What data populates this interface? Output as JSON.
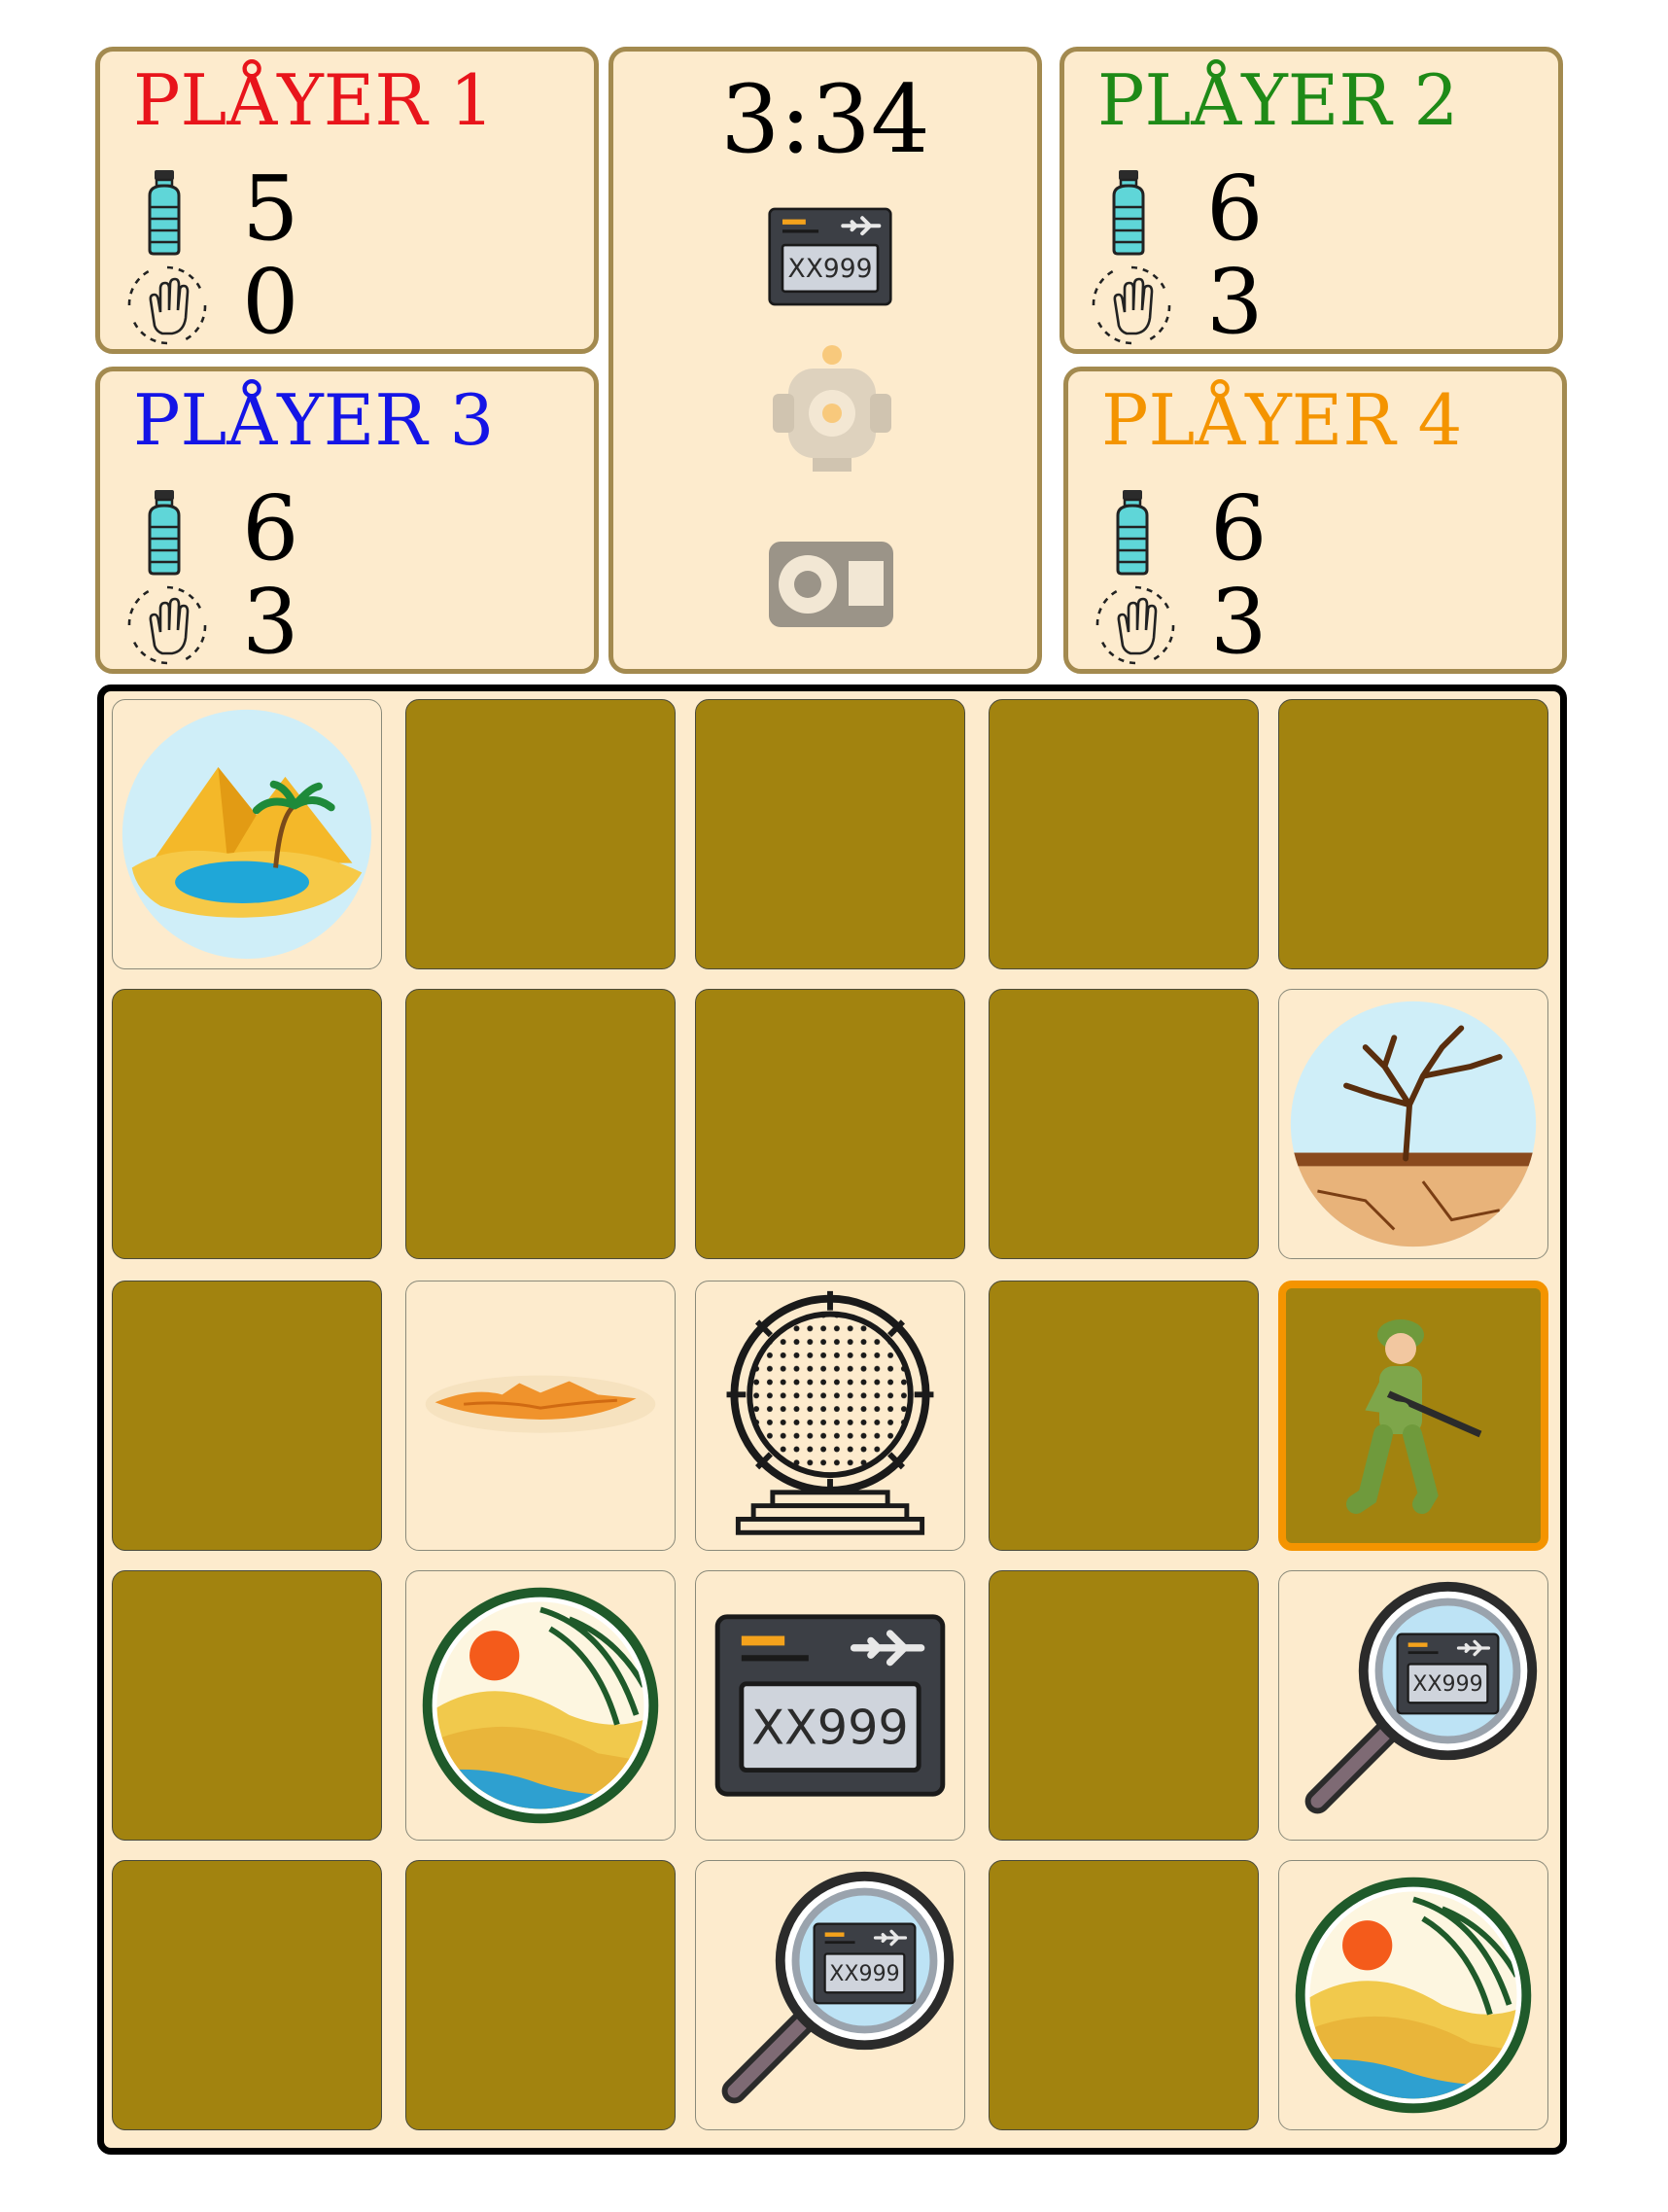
{
  "timer": "3:34",
  "players": [
    {
      "label": "PLÅYER 1",
      "color": "#e8141b",
      "water": "5",
      "actions": "0"
    },
    {
      "label": "PLÅYER 2",
      "color": "#1e8a17",
      "water": "6",
      "actions": "3"
    },
    {
      "label": "PLÅYER 3",
      "color": "#1414e6",
      "water": "6",
      "actions": "3"
    },
    {
      "label": "PLÅYER 4",
      "color": "#f49400",
      "water": "6",
      "actions": "3"
    }
  ],
  "collected_parts": [
    {
      "name": "plane-ticket-part",
      "found": true
    },
    {
      "name": "engine-part",
      "found": false
    },
    {
      "name": "navigation-part",
      "found": false
    }
  ],
  "board": {
    "rows": 5,
    "cols": 5,
    "tiles": [
      [
        "oasis",
        "hidden",
        "hidden",
        "hidden",
        "hidden"
      ],
      [
        "hidden",
        "hidden",
        "hidden",
        "hidden",
        "drought"
      ],
      [
        "hidden",
        "tunnel",
        "stargate",
        "hidden",
        "player-soldier"
      ],
      [
        "hidden",
        "mirage-landscape",
        "plane-ticket",
        "hidden",
        "clue-magnifier"
      ],
      [
        "hidden",
        "hidden",
        "clue-magnifier",
        "hidden",
        "mirage-landscape"
      ]
    ],
    "ticket_code": "XX999"
  },
  "colors": {
    "hidden_tile": "#a2830f",
    "open_tile": "#fdebcd",
    "panel_border": "#a38a4f",
    "player_highlight": "#f49400"
  }
}
